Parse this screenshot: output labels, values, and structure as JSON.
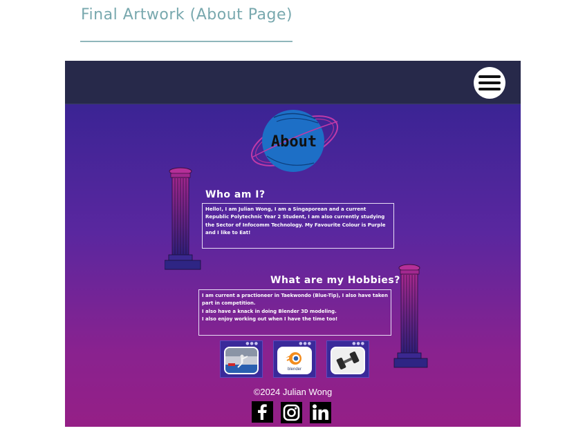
{
  "page": {
    "heading": "Final Artwork (About Page)"
  },
  "artwork": {
    "header": {
      "menu_icon": "hamburger-menu-icon"
    },
    "logo": {
      "text": "About"
    },
    "who_am_i": {
      "title": "Who am I?",
      "body": "Hello!, I am Julian Wong, I am a Singaporean and a current Republic Polytechnic Year 2 Student, I am also currently studying the Sector of Infocomm Technology. My Favourite Colour is Purple and I like to Eat!"
    },
    "hobbies": {
      "title": "What are my Hobbies?",
      "lines": [
        "I am current a practioneer in Taekwondo (Blue-Tip), I also have taken part in competition.",
        "I also have a knack in doing Blender 3D modeling.",
        "I also enjoy working out when I have the time too!"
      ],
      "cards": [
        {
          "name": "taekwondo-image",
          "dots": "●●●"
        },
        {
          "name": "blender-logo",
          "dots": "●●●",
          "caption": "blender"
        },
        {
          "name": "dumbbell-image",
          "dots": "●●●"
        }
      ]
    },
    "footer": {
      "copyright": "©2024 Julian Wong",
      "social_icons": [
        "facebook-icon",
        "instagram-icon",
        "linkedin-icon"
      ]
    },
    "colors": {
      "header_bg": "#27294a",
      "gradient_top": "#3b2494",
      "gradient_bottom": "#951f86",
      "logo_blue": "#1d6fc6",
      "ring_pink": "#c03aa8"
    }
  }
}
